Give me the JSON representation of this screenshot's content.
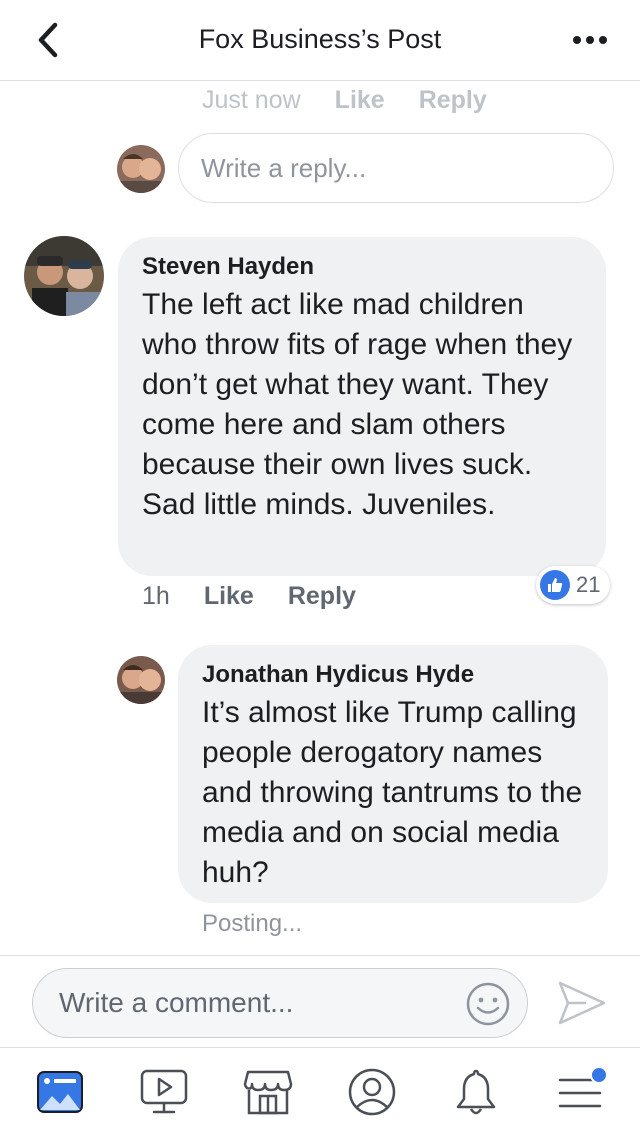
{
  "header": {
    "title": "Fox Business’s Post",
    "back_icon": "chevron-left-icon",
    "more_icon": "more-dots-icon"
  },
  "top_reply_meta": {
    "time": "Just now",
    "like": "Like",
    "reply": "Reply"
  },
  "reply_box": {
    "placeholder": "Write a reply..."
  },
  "comment_1": {
    "author": "Steven Hayden",
    "text": "The left act like mad children who throw fits of rage when they don’t get what they want. They come here and slam others because their own lives suck. Sad little minds. Juveniles.",
    "time": "1h",
    "like": "Like",
    "reply": "Reply",
    "reaction_count": "21"
  },
  "comment_2": {
    "author": "Jonathan Hydicus Hyde",
    "text": "It’s almost like Trump calling people derogatory names and throwing tantrums to the media and on social media huh?",
    "status": "Posting..."
  },
  "composer": {
    "placeholder": "Write a comment..."
  },
  "tabbar": {
    "items": [
      "news-feed-icon",
      "watch-icon",
      "marketplace-icon",
      "profile-icon",
      "notifications-icon",
      "menu-icon"
    ]
  },
  "colors": {
    "accent": "#3578e5",
    "bubble": "#f0f1f3",
    "muted_text": "#90949c"
  }
}
